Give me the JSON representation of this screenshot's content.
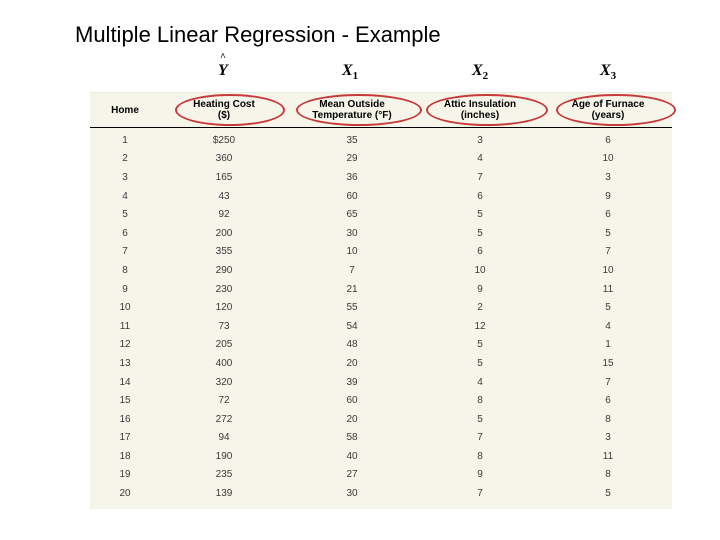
{
  "title": "Multiple Linear Regression - Example",
  "vars": {
    "y": "Y",
    "x1_base": "X",
    "x1_sub": "1",
    "x2_base": "X",
    "x2_sub": "2",
    "x3_base": "X",
    "x3_sub": "3"
  },
  "headers": {
    "home": "Home",
    "heating_l1": "Heating Cost",
    "heating_l2": "($)",
    "temp_l1": "Mean Outside",
    "temp_l2": "Temperature (°F)",
    "attic_l1": "Attic Insulation",
    "attic_l2": "(inches)",
    "age_l1": "Age of Furnace",
    "age_l2": "(years)"
  },
  "chart_data": {
    "type": "table",
    "title": "Multiple Linear Regression - Example",
    "columns": [
      "Home",
      "Heating Cost ($)",
      "Mean Outside Temperature (°F)",
      "Attic Insulation (inches)",
      "Age of Furnace (years)"
    ],
    "variable_roles": {
      "y_hat": "Heating Cost ($)",
      "X1": "Mean Outside Temperature (°F)",
      "X2": "Attic Insulation (inches)",
      "X3": "Age of Furnace (years)"
    },
    "rows": [
      {
        "home": 1,
        "heat": "$250",
        "temp": 35,
        "attic": 3,
        "age": 6
      },
      {
        "home": 2,
        "heat": 360,
        "temp": 29,
        "attic": 4,
        "age": 10
      },
      {
        "home": 3,
        "heat": 165,
        "temp": 36,
        "attic": 7,
        "age": 3
      },
      {
        "home": 4,
        "heat": 43,
        "temp": 60,
        "attic": 6,
        "age": 9
      },
      {
        "home": 5,
        "heat": 92,
        "temp": 65,
        "attic": 5,
        "age": 6
      },
      {
        "home": 6,
        "heat": 200,
        "temp": 30,
        "attic": 5,
        "age": 5
      },
      {
        "home": 7,
        "heat": 355,
        "temp": 10,
        "attic": 6,
        "age": 7
      },
      {
        "home": 8,
        "heat": 290,
        "temp": 7,
        "attic": 10,
        "age": 10
      },
      {
        "home": 9,
        "heat": 230,
        "temp": 21,
        "attic": 9,
        "age": 11
      },
      {
        "home": 10,
        "heat": 120,
        "temp": 55,
        "attic": 2,
        "age": 5
      },
      {
        "home": 11,
        "heat": 73,
        "temp": 54,
        "attic": 12,
        "age": 4
      },
      {
        "home": 12,
        "heat": 205,
        "temp": 48,
        "attic": 5,
        "age": 1
      },
      {
        "home": 13,
        "heat": 400,
        "temp": 20,
        "attic": 5,
        "age": 15
      },
      {
        "home": 14,
        "heat": 320,
        "temp": 39,
        "attic": 4,
        "age": 7
      },
      {
        "home": 15,
        "heat": 72,
        "temp": 60,
        "attic": 8,
        "age": 6
      },
      {
        "home": 16,
        "heat": 272,
        "temp": 20,
        "attic": 5,
        "age": 8
      },
      {
        "home": 17,
        "heat": 94,
        "temp": 58,
        "attic": 7,
        "age": 3
      },
      {
        "home": 18,
        "heat": 190,
        "temp": 40,
        "attic": 8,
        "age": 11
      },
      {
        "home": 19,
        "heat": 235,
        "temp": 27,
        "attic": 9,
        "age": 8
      },
      {
        "home": 20,
        "heat": 139,
        "temp": 30,
        "attic": 7,
        "age": 5
      }
    ]
  }
}
